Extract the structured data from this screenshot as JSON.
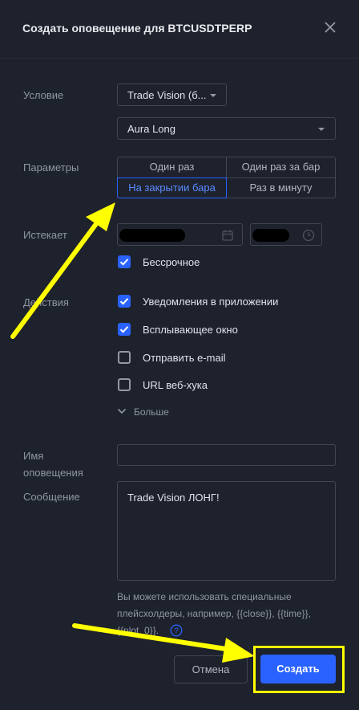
{
  "header": {
    "title": "Создать оповещение для BTCUSDTPERP"
  },
  "condition": {
    "label": "Условие",
    "source_value": "Trade Vision (б...",
    "signal_value": "Aura Long"
  },
  "parameters": {
    "label": "Параметры",
    "options": [
      "Один раз",
      "Один раз за бар",
      "На закрытии бара",
      "Раз в минуту"
    ],
    "selected": "На закрытии бара"
  },
  "expiry": {
    "label": "Истекает",
    "open_ended_label": "Бессрочное",
    "open_ended_checked": true
  },
  "actions": {
    "label": "Действия",
    "items": [
      {
        "label": "Уведомления в приложении",
        "checked": true
      },
      {
        "label": "Всплывающее окно",
        "checked": true
      },
      {
        "label": "Отправить e-mail",
        "checked": false
      },
      {
        "label": "URL веб-хука",
        "checked": false
      }
    ],
    "more_label": "Больше"
  },
  "alert_name": {
    "label_line1": "Имя",
    "label_line2": "оповещения",
    "value": ""
  },
  "message": {
    "label": "Сообщение",
    "value": "Trade Vision ЛОНГ!",
    "hint_line1": "Вы можете использовать специальные",
    "hint_line2": "плейсхолдеры, например, {{close}}, {{time}},",
    "hint_line3": "{{plot_0}}."
  },
  "footer": {
    "cancel_label": "Отмена",
    "create_label": "Создать"
  },
  "colors": {
    "accent": "#2962ff",
    "annotation": "#ffff00",
    "background": "#1e222d"
  }
}
